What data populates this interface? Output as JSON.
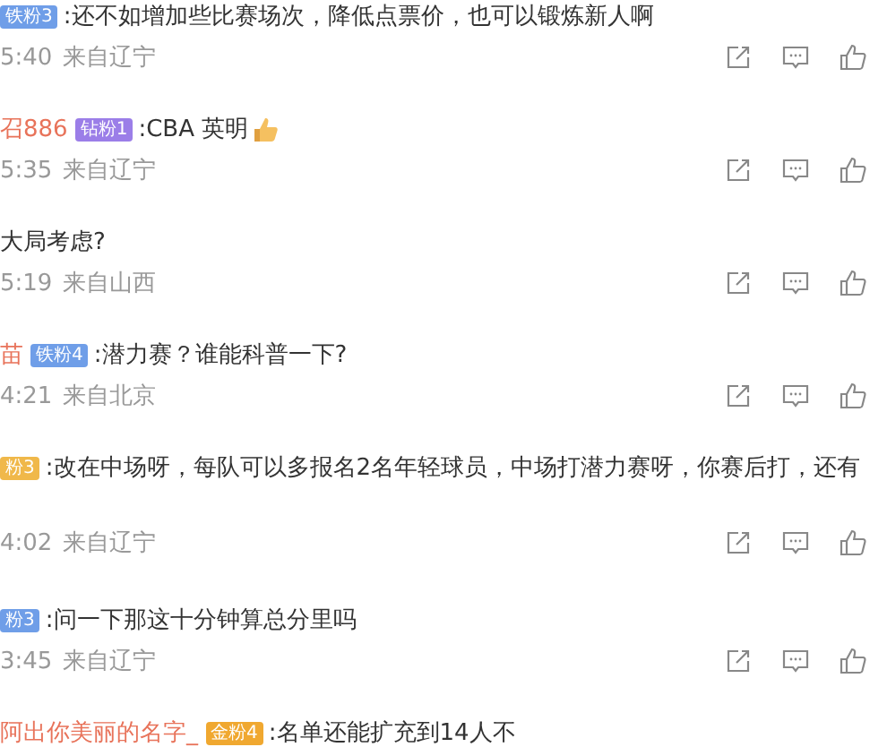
{
  "comments": [
    {
      "badge": {
        "label": "铁粉3",
        "color": "#6f9ee8"
      },
      "text": ":还不如增加些比赛场次，降低点票价，也可以锻炼新人啊",
      "time": "5:40",
      "location": "来自辽宁"
    },
    {
      "user": "召886",
      "badge": {
        "label": "钻粉1",
        "color": "#9b7ee8"
      },
      "text": ":CBA 英明",
      "has_emoji": true,
      "time": "5:35",
      "location": "来自辽宁"
    },
    {
      "text": "大局考虑?",
      "time": "5:19",
      "location": "来自山西"
    },
    {
      "user": "苗",
      "badge": {
        "label": "铁粉4",
        "color": "#6f9ee8"
      },
      "text": ":潜力赛？谁能科普一下?",
      "time": "4:21",
      "location": "来自北京"
    },
    {
      "badge": {
        "label": "粉3",
        "color": "#f0b84a"
      },
      "text": ":改在中场呀，每队可以多报名2名年轻球员，中场打潜力赛呀，你赛后打，还有",
      "time": "4:02",
      "location": "来自辽宁"
    },
    {
      "badge": {
        "label": "粉3",
        "color": "#6f9ee8"
      },
      "text": ":问一下那这十分钟算总分里吗",
      "time": "3:45",
      "location": "来自辽宁"
    },
    {
      "user": "阿出你美丽的名字_",
      "badge": {
        "label": "金粉4",
        "color": "#f0a830"
      },
      "text": ":名单还能扩充到14人不"
    }
  ]
}
